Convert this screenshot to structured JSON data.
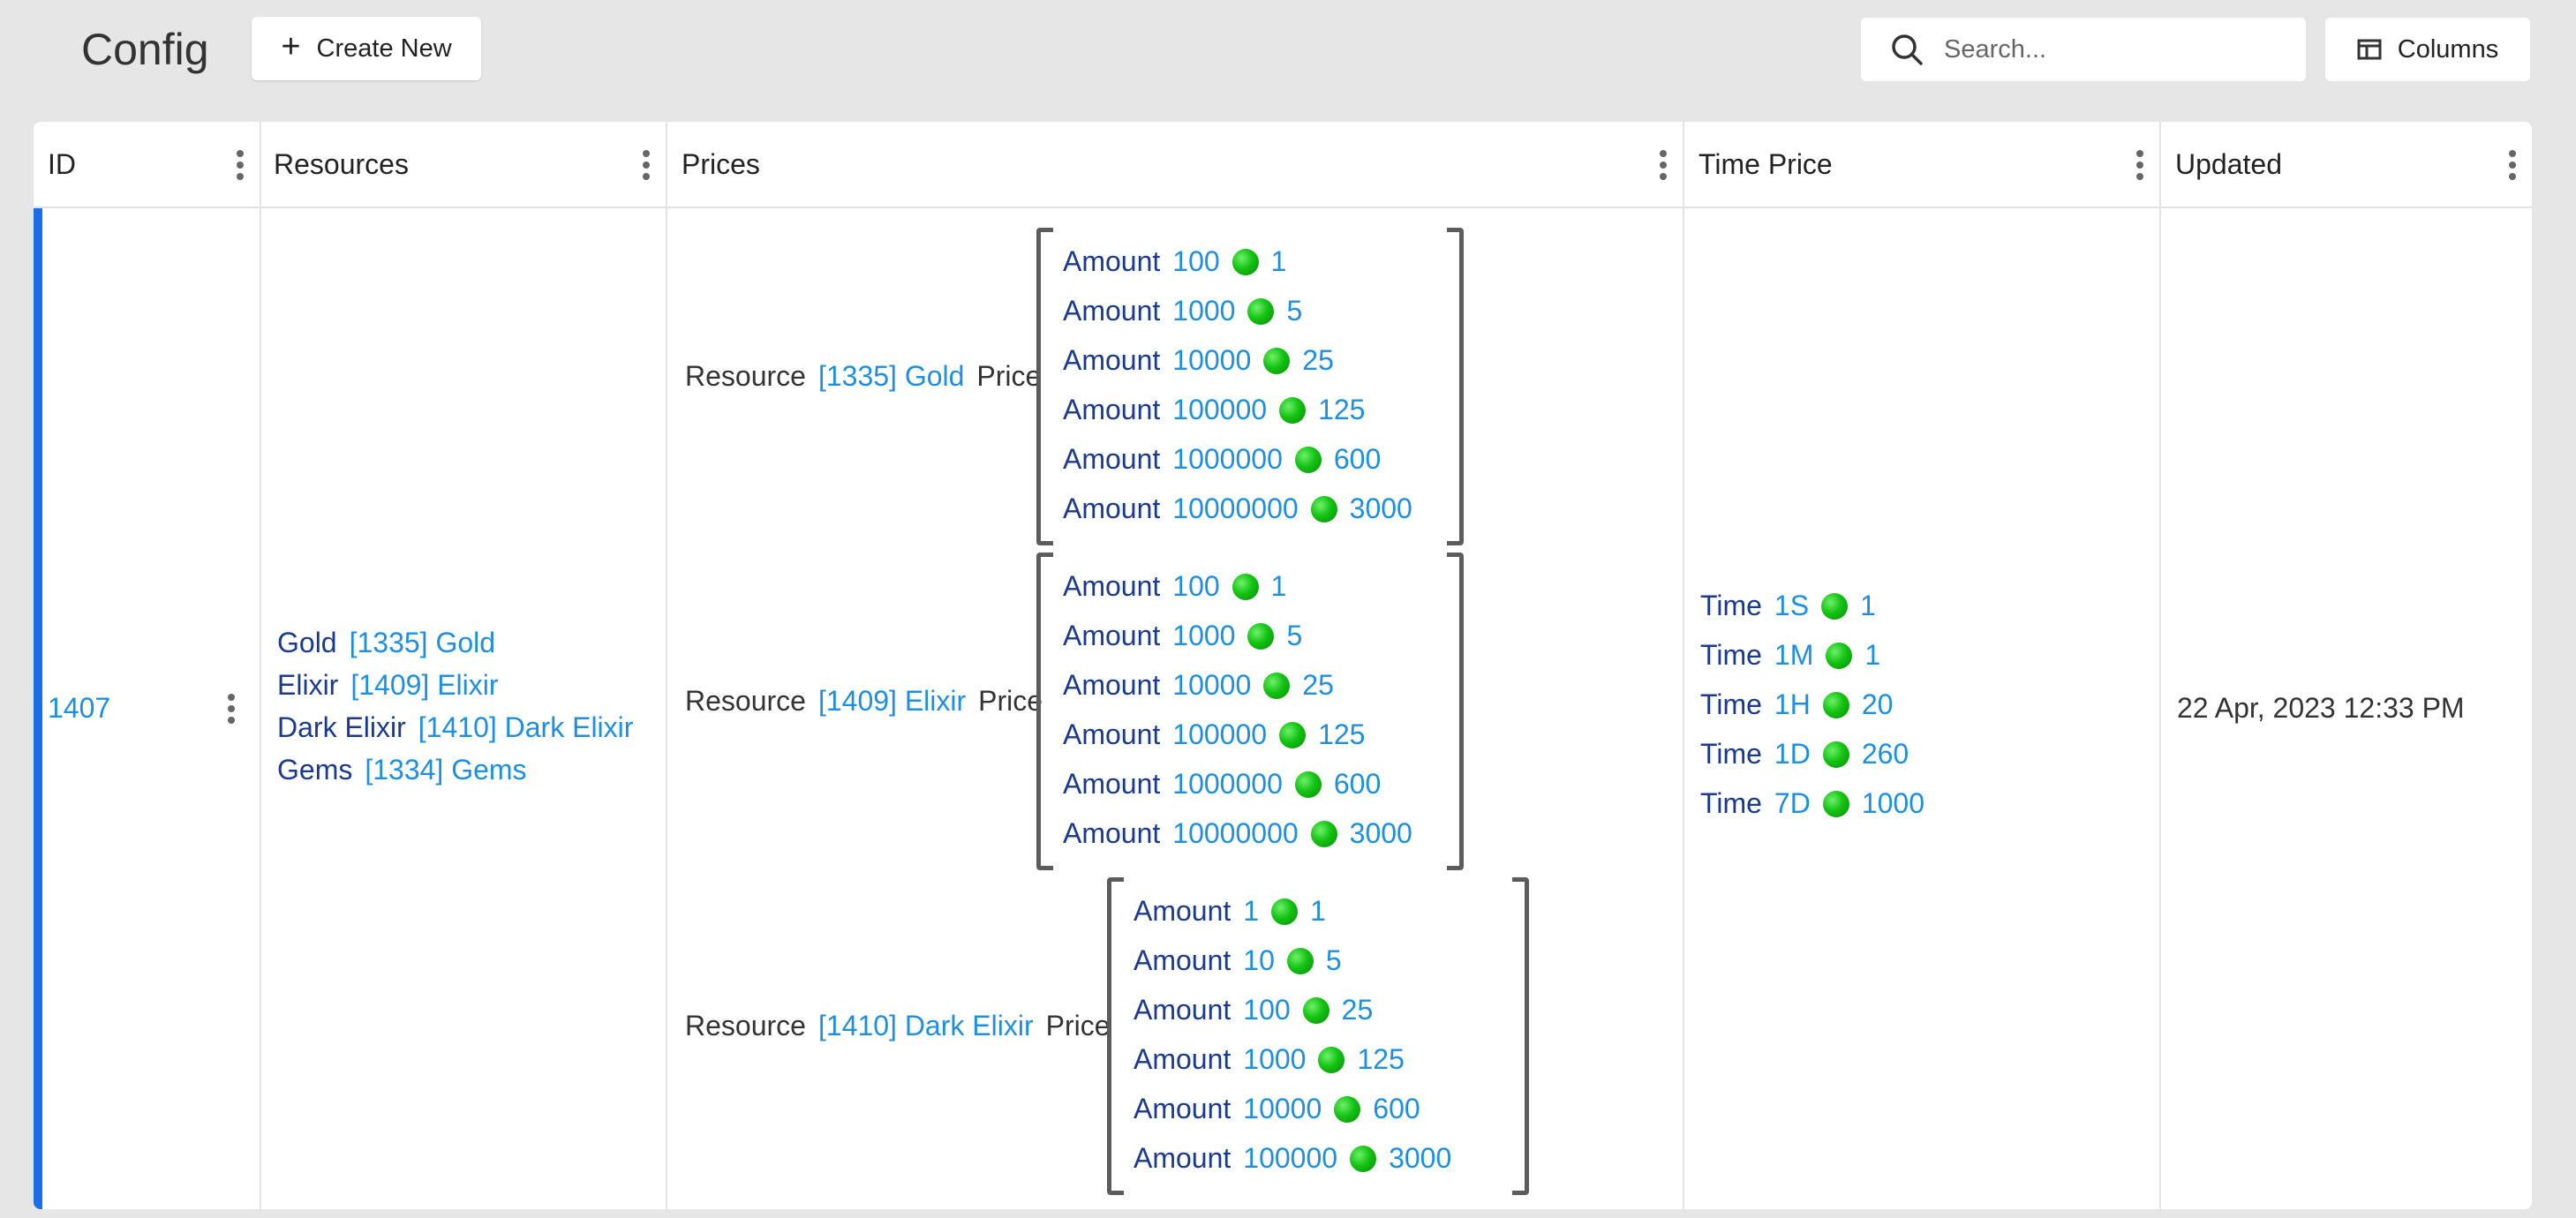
{
  "header": {
    "title": "Config",
    "create_label": "Create New",
    "search_placeholder": "Search...",
    "columns_label": "Columns"
  },
  "table": {
    "columns": [
      "ID",
      "Resources",
      "Prices",
      "Time Price",
      "Updated"
    ],
    "row": {
      "id": "1407",
      "resources": [
        {
          "name": "Gold",
          "ref": "[1335] Gold"
        },
        {
          "name": "Elixir",
          "ref": "[1409] Elixir"
        },
        {
          "name": "Dark Elixir",
          "ref": "[1410] Dark Elixir"
        },
        {
          "name": "Gems",
          "ref": "[1334] Gems"
        }
      ],
      "prices": [
        {
          "resource_label": "Resource",
          "resource": "[1335] Gold",
          "price_label": "Price",
          "tiers": [
            {
              "label": "Amount",
              "amount": "100",
              "cost": "1"
            },
            {
              "label": "Amount",
              "amount": "1000",
              "cost": "5"
            },
            {
              "label": "Amount",
              "amount": "10000",
              "cost": "25"
            },
            {
              "label": "Amount",
              "amount": "100000",
              "cost": "125"
            },
            {
              "label": "Amount",
              "amount": "1000000",
              "cost": "600"
            },
            {
              "label": "Amount",
              "amount": "10000000",
              "cost": "3000"
            }
          ]
        },
        {
          "resource_label": "Resource",
          "resource": "[1409] Elixir",
          "price_label": "Price",
          "tiers": [
            {
              "label": "Amount",
              "amount": "100",
              "cost": "1"
            },
            {
              "label": "Amount",
              "amount": "1000",
              "cost": "5"
            },
            {
              "label": "Amount",
              "amount": "10000",
              "cost": "25"
            },
            {
              "label": "Amount",
              "amount": "100000",
              "cost": "125"
            },
            {
              "label": "Amount",
              "amount": "1000000",
              "cost": "600"
            },
            {
              "label": "Amount",
              "amount": "10000000",
              "cost": "3000"
            }
          ]
        },
        {
          "resource_label": "Resource",
          "resource": "[1410] Dark Elixir",
          "price_label": "Price",
          "tiers": [
            {
              "label": "Amount",
              "amount": "1",
              "cost": "1"
            },
            {
              "label": "Amount",
              "amount": "10",
              "cost": "5"
            },
            {
              "label": "Amount",
              "amount": "100",
              "cost": "25"
            },
            {
              "label": "Amount",
              "amount": "1000",
              "cost": "125"
            },
            {
              "label": "Amount",
              "amount": "10000",
              "cost": "600"
            },
            {
              "label": "Amount",
              "amount": "100000",
              "cost": "3000"
            }
          ]
        }
      ],
      "time_price": [
        {
          "label": "Time",
          "time": "1S",
          "cost": "1"
        },
        {
          "label": "Time",
          "time": "1M",
          "cost": "1"
        },
        {
          "label": "Time",
          "time": "1H",
          "cost": "20"
        },
        {
          "label": "Time",
          "time": "1D",
          "cost": "260"
        },
        {
          "label": "Time",
          "time": "7D",
          "cost": "1000"
        }
      ],
      "updated": "22 Apr, 2023 12:33 PM"
    }
  },
  "colors": {
    "accent": "#1a6fe6",
    "link": "#1e8fe0",
    "label": "#1b3a8c",
    "gem": "#13c313"
  }
}
